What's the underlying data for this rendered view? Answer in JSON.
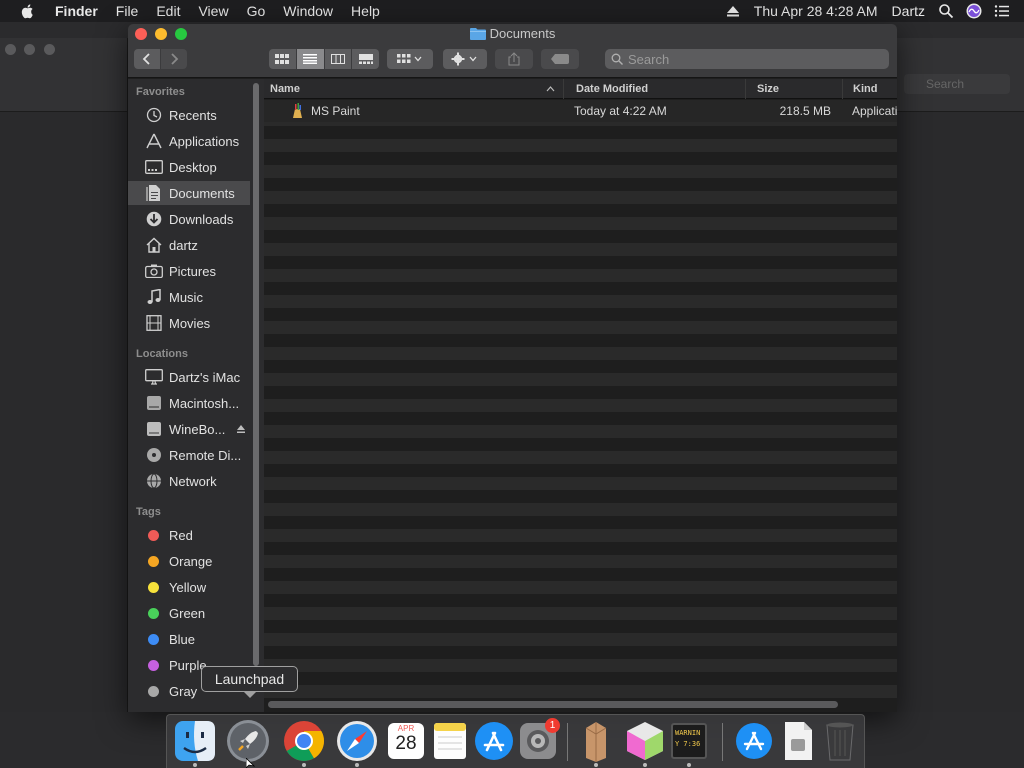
{
  "menubar": {
    "app_name": "Finder",
    "menus": [
      "File",
      "Edit",
      "View",
      "Go",
      "Window",
      "Help"
    ],
    "datetime": "Thu Apr 28  4:28 AM",
    "user": "Dartz"
  },
  "background_window": {
    "search_placeholder": "Search"
  },
  "window": {
    "title": "Documents",
    "search_placeholder": "Search"
  },
  "sidebar": {
    "favorites_header": "Favorites",
    "favorites": [
      "Recents",
      "Applications",
      "Desktop",
      "Documents",
      "Downloads",
      "dartz",
      "Pictures",
      "Music",
      "Movies"
    ],
    "selected": "Documents",
    "locations_header": "Locations",
    "locations": [
      "Dartz's iMac",
      "Macintosh...",
      "WineBo...",
      "Remote Di...",
      "Network"
    ],
    "tags_header": "Tags",
    "tags": [
      {
        "label": "Red",
        "color": "#f05b57"
      },
      {
        "label": "Orange",
        "color": "#f5a623"
      },
      {
        "label": "Yellow",
        "color": "#f7e23b"
      },
      {
        "label": "Green",
        "color": "#49d15a"
      },
      {
        "label": "Blue",
        "color": "#3d8cf5"
      },
      {
        "label": "Purple",
        "color": "#c660e0"
      },
      {
        "label": "Gray",
        "color": "#a8a8a8"
      }
    ]
  },
  "file_list": {
    "columns": [
      "Name",
      "Date Modified",
      "Size",
      "Kind"
    ],
    "sort_column": "Name",
    "rows": [
      {
        "name": "MS Paint",
        "date_modified": "Today at 4:22 AM",
        "size": "218.5 MB",
        "kind": "Application"
      }
    ]
  },
  "dock": {
    "tooltip": "Launchpad",
    "apps": [
      "Finder",
      "Launchpad",
      "Google Chrome",
      "Safari",
      "Calendar",
      "Notes",
      "App Store",
      "System Preferences",
      "Wine",
      "Grapher",
      "Console",
      "App Store Downloads",
      "Document",
      "Trash"
    ],
    "calendar_month": "APR",
    "calendar_day": "28",
    "sysprefs_badge": "1",
    "console_text": "WARNIN Y 7:36"
  }
}
